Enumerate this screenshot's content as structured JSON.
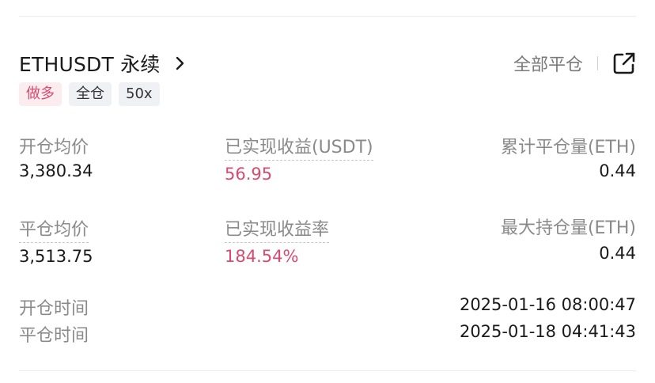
{
  "header": {
    "symbol": "ETHUSDT 永续",
    "close_all_label": "全部平仓"
  },
  "tags": {
    "side": "做多",
    "margin_mode": "全仓",
    "leverage": "50x"
  },
  "stats": {
    "open_avg_price_label": "开仓均价",
    "open_avg_price": "3,380.34",
    "realized_pnl_label": "已实现收益(USDT)",
    "realized_pnl": "56.95",
    "cum_close_qty_label": "累计平仓量(ETH)",
    "cum_close_qty": "0.44",
    "close_avg_price_label": "平仓均价",
    "close_avg_price": "3,513.75",
    "realized_pnl_rate_label": "已实现收益率",
    "realized_pnl_rate": "184.54%",
    "max_position_label": "最大持仓量(ETH)",
    "max_position": "0.44",
    "open_time_label": "开仓时间",
    "open_time": "2025-01-16 08:00:47",
    "close_time_label": "平仓时间",
    "close_time": "2025-01-18 04:41:43"
  },
  "colors": {
    "profit": "#d94a6e",
    "long_tag_bg": "#fbecef",
    "neutral_tag_bg": "#f0f1f5"
  },
  "icons": {
    "chevron": "chevron-right-icon",
    "share": "share-external-icon"
  }
}
